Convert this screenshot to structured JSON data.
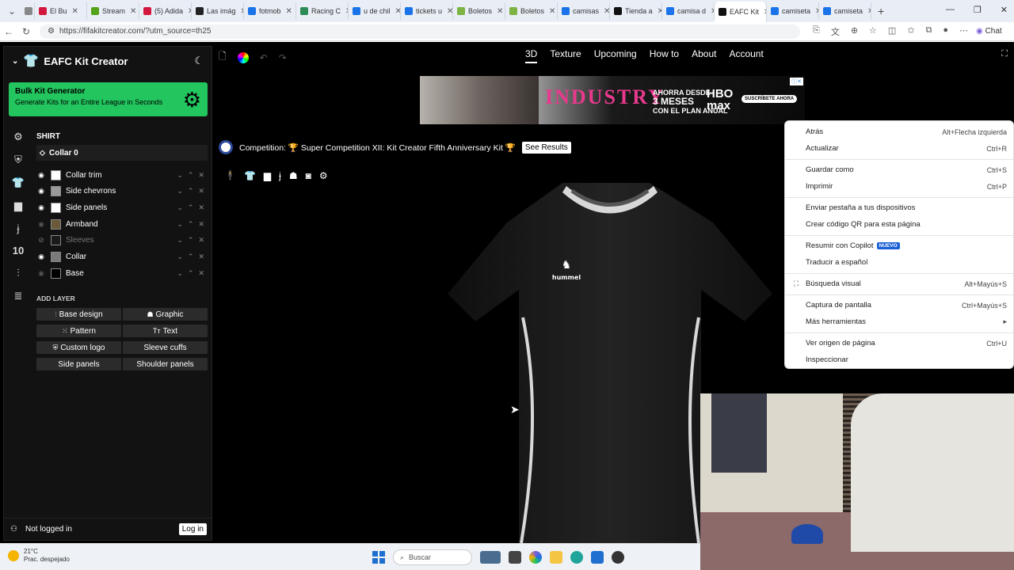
{
  "browser": {
    "tabs": [
      {
        "title": "",
        "color": "#888888"
      },
      {
        "title": "El Bu",
        "color": "#d4183d"
      },
      {
        "title": "Stream",
        "color": "#53a318"
      },
      {
        "title": "(5) Adida",
        "color": "#d4183d"
      },
      {
        "title": "Las imág",
        "color": "#222222"
      },
      {
        "title": "fotmob",
        "color": "#1a73e8"
      },
      {
        "title": "Racing C",
        "color": "#2e8b57"
      },
      {
        "title": "u de chil",
        "color": "#1a73e8"
      },
      {
        "title": "tickets u",
        "color": "#1a73e8"
      },
      {
        "title": "Boletos",
        "color": "#7cb342"
      },
      {
        "title": "Boletos",
        "color": "#7cb342"
      },
      {
        "title": "camisas",
        "color": "#1a73e8"
      },
      {
        "title": "Tienda a",
        "color": "#111111"
      },
      {
        "title": "camisa d",
        "color": "#1a73e8"
      },
      {
        "title": "EAFC Kit",
        "color": "#111111",
        "active": true
      },
      {
        "title": "camiseta",
        "color": "#1a73e8"
      },
      {
        "title": "camiseta",
        "color": "#1a73e8"
      }
    ],
    "url": "https://fifakitcreator.com/?utm_source=th25",
    "chat_label": "Chat"
  },
  "app": {
    "brand": "EAFC Kit Creator",
    "bulk": {
      "title": "Bulk Kit Generator",
      "subtitle": "Generate Kits for an Entire League in Seconds"
    },
    "section_title": "SHIRT",
    "selected_layer": "Collar 0",
    "layers": [
      {
        "name": "Collar trim",
        "swatch": "#ffffff",
        "visible": true
      },
      {
        "name": "Side chevrons",
        "swatch": "#9a9a9a",
        "visible": true
      },
      {
        "name": "Side panels",
        "swatch": "#ffffff",
        "visible": true
      },
      {
        "name": "Armband",
        "swatch": "#6b5a3a",
        "visible": false
      },
      {
        "name": "Sleeves",
        "swatch": "#1a1a1a",
        "visible": false
      },
      {
        "name": "Collar",
        "swatch": "#7a7a7a",
        "visible": true
      },
      {
        "name": "Base",
        "swatch": "#000000",
        "visible": false
      }
    ],
    "add_layer_title": "ADD LAYER",
    "add_buttons": [
      "Base design",
      "Graphic",
      "Pattern",
      "Text",
      "Custom logo",
      "Sleeve cuffs",
      "Side panels",
      "Shoulder panels"
    ],
    "login_status": "Not logged in",
    "login_button": "Log in",
    "nav": [
      "3D",
      "Texture",
      "Upcoming",
      "How to",
      "About",
      "Account"
    ],
    "competition": "Competition: 🏆 Super Competition XII: Kit Creator Fifth Anniversary Kit 🏆",
    "see_results": "See Results",
    "shirt_brand": "hummel",
    "accent": "#22c55e"
  },
  "ad": {
    "title": "INDUSTRY",
    "promo_1": "AHORRA DESDE",
    "promo_2": "3 MESES",
    "promo_3": "CON EL PLAN ANUAL",
    "logo_1": "HBO",
    "logo_2": "max",
    "cta": "SUSCRÍBETE AHORA"
  },
  "context_menu": [
    {
      "label": "Atrás",
      "shortcut": "Alt+Flecha izquierda"
    },
    {
      "label": "Actualizar",
      "shortcut": "Ctrl+R"
    },
    {
      "sep": true
    },
    {
      "label": "Guardar como",
      "shortcut": "Ctrl+S"
    },
    {
      "label": "Imprimir",
      "shortcut": "Ctrl+P"
    },
    {
      "sep": true
    },
    {
      "label": "Enviar pestaña a tus dispositivos",
      "shortcut": ""
    },
    {
      "label": "Crear código QR para esta página",
      "shortcut": ""
    },
    {
      "sep": true
    },
    {
      "label": "Resumir con Copilot",
      "shortcut": "",
      "badge": "NUEVO"
    },
    {
      "label": "Traducir a español",
      "shortcut": ""
    },
    {
      "sep": true
    },
    {
      "label": "Búsqueda visual",
      "shortcut": "Alt+Mayús+S",
      "icon": "⛶"
    },
    {
      "sep": true
    },
    {
      "label": "Captura de pantalla",
      "shortcut": "Ctrl+Mayús+S"
    },
    {
      "label": "Más herramientas",
      "shortcut": "▸"
    },
    {
      "sep": true
    },
    {
      "label": "Ver origen de página",
      "shortcut": "Ctrl+U"
    },
    {
      "label": "Inspeccionar",
      "shortcut": ""
    }
  ],
  "taskbar": {
    "temp": "21°C",
    "weather": "Prac. despejado",
    "search": "Buscar"
  }
}
